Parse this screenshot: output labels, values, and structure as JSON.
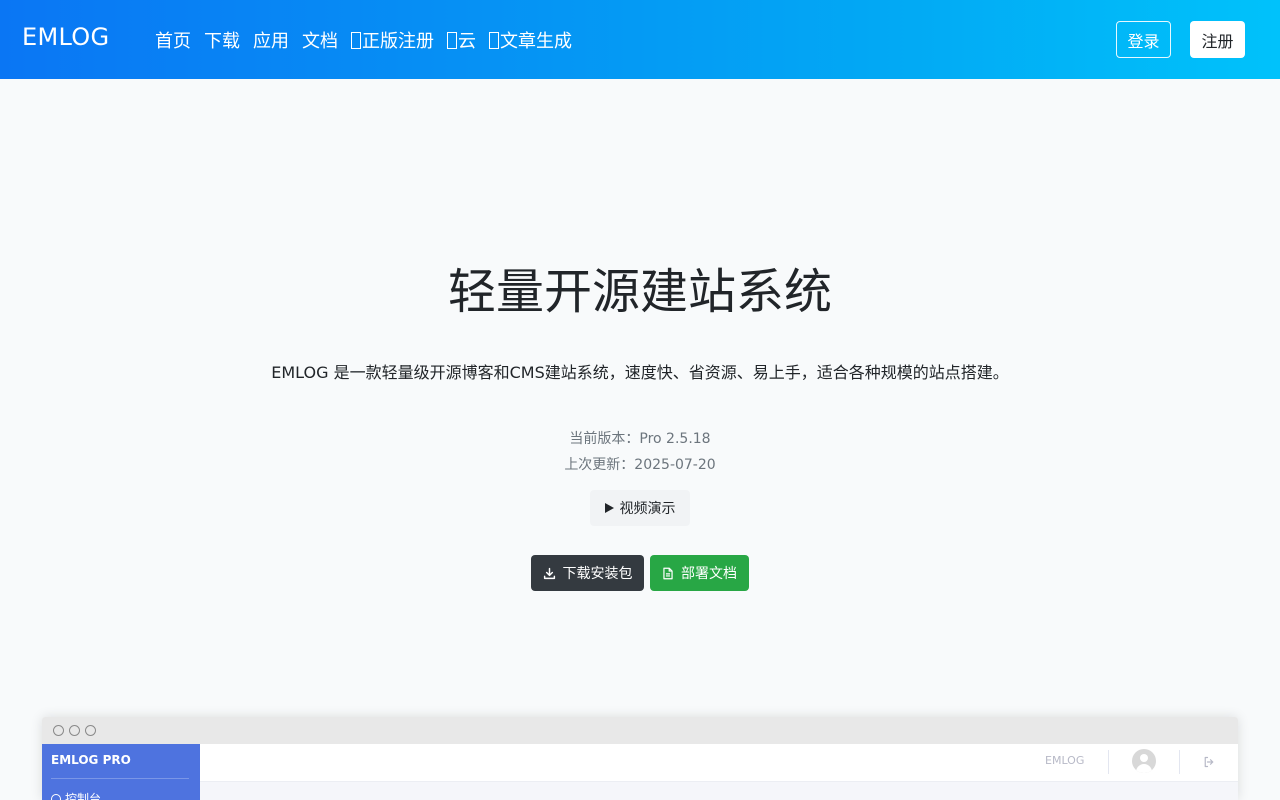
{
  "navbar": {
    "brand": "EMLOG",
    "links": [
      {
        "label": "首页",
        "glyph": false
      },
      {
        "label": "下载",
        "glyph": false
      },
      {
        "label": "应用",
        "glyph": false
      },
      {
        "label": "文档",
        "glyph": false
      },
      {
        "label": "正版注册",
        "glyph": true
      },
      {
        "label": "云",
        "glyph": true
      },
      {
        "label": "文章生成",
        "glyph": true
      }
    ],
    "login_label": "登录",
    "register_label": "注册"
  },
  "hero": {
    "title": "轻量开源建站系统",
    "description": "EMLOG 是一款轻量级开源博客和CMS建站系统，速度快、省资源、易上手，适合各种规模的站点搭建。",
    "version_line": "当前版本：Pro 2.5.18",
    "updated_line": "上次更新：2025-07-20",
    "video_label": "视频演示",
    "download_label": "下载安装包",
    "docs_label": "部署文档"
  },
  "preview": {
    "brand": "EMLOG PRO",
    "menu_item": "控制台",
    "site_name": "EMLOG"
  },
  "colors": {
    "navbar_start": "#0a76f4",
    "navbar_end": "#00c2fb",
    "download_button": "#343a40",
    "docs_button": "#28a745",
    "preview_sidebar": "#4e73df"
  }
}
